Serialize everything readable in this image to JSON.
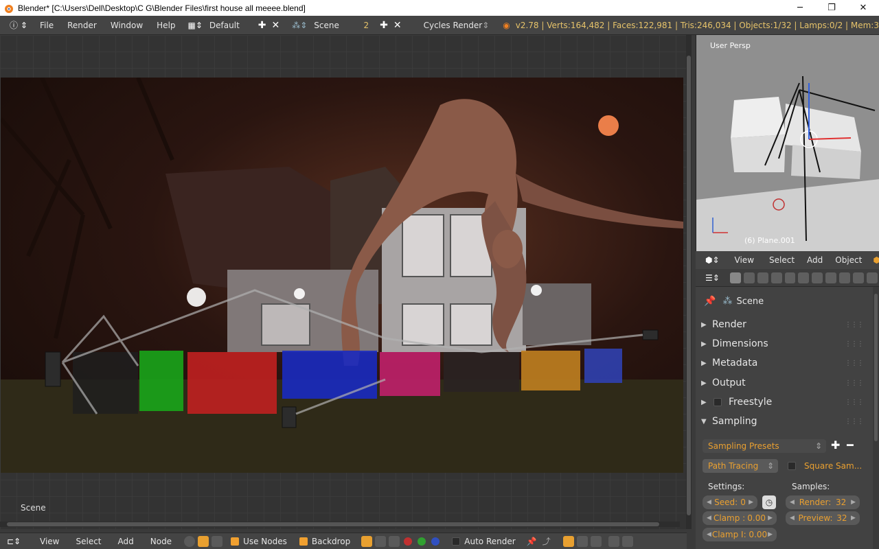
{
  "window": {
    "title": "Blender* [C:\\Users\\Dell\\Desktop\\C G\\Blender Files\\first house all meeee.blend]",
    "minimize": "─",
    "maximize": "❐",
    "close": "✕"
  },
  "topbar": {
    "menus": [
      "File",
      "Render",
      "Window",
      "Help"
    ],
    "screen_layout": "Default",
    "scene": "Scene",
    "scene_users": "2",
    "render_engine": "Cycles Render",
    "stats": "v2.78 | Verts:164,482 | Faces:122,981 | Tris:246,034 | Objects:1/32 | Lamps:0/2 | Mem:3"
  },
  "node_editor": {
    "scene_label": "Scene",
    "bottom_menus": [
      "View",
      "Select",
      "Add",
      "Node"
    ],
    "use_nodes_label": "Use Nodes",
    "backdrop_label": "Backdrop",
    "auto_render_label": "Auto Render",
    "use_nodes": true,
    "backdrop": true,
    "auto_render": false
  },
  "viewport": {
    "view_label": "User Persp",
    "object_label": "(6) Plane.001",
    "menus": [
      "View",
      "Select",
      "Add",
      "Object"
    ],
    "mode": "Ob"
  },
  "properties": {
    "context": "Scene",
    "panels": [
      {
        "label": "Render",
        "expanded": false
      },
      {
        "label": "Dimensions",
        "expanded": false
      },
      {
        "label": "Metadata",
        "expanded": false
      },
      {
        "label": "Output",
        "expanded": false
      },
      {
        "label": "Freestyle",
        "expanded": false
      },
      {
        "label": "Sampling",
        "expanded": true
      }
    ],
    "sampling": {
      "presets": "Sampling Presets",
      "integrator": "Path Tracing",
      "square_samples": "Square Sam...",
      "settings_label": "Settings:",
      "samples_label": "Samples:",
      "seed_label": "Seed:",
      "seed": "0",
      "clamp_label": "Clamp :",
      "clamp": "0.00",
      "clamp_indirect": "Clamp I: 0.00",
      "render_label": "Render:",
      "render": "32",
      "preview_label": "Preview:",
      "preview": "32"
    }
  },
  "colors": {
    "accent": "#eaa030",
    "header_bg": "#444444",
    "panel_bg": "#424242"
  }
}
